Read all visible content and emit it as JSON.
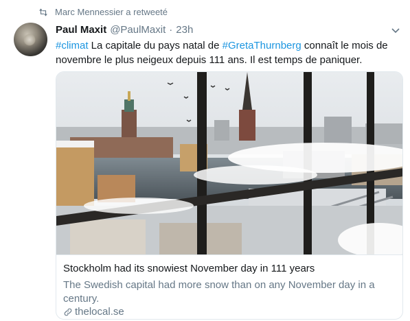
{
  "retweet_context": {
    "icon": "retweet-icon",
    "text": "Marc Mennessier a retweeté"
  },
  "tweet": {
    "author": {
      "display_name": "Paul Maxit",
      "screen_name": "@PaulMaxit",
      "separator": "·",
      "time": "23h"
    },
    "text": {
      "hashtag1": "#climat",
      "part1": " La capitale du pays natal de ",
      "hashtag2": "#GretaThurnberg",
      "part2": " connaît le mois de novembre le plus neigeux depuis 111 ans. Il est temps de paniquer."
    },
    "card": {
      "title": "Stockholm had its snowiest November day in 111 years",
      "description": "The Swedish capital had more snow than on any November day in a century.",
      "domain": "thelocal.se"
    }
  },
  "colors": {
    "link": "#1b95e0",
    "secondary": "#657786",
    "border": "#e1e8ed"
  }
}
